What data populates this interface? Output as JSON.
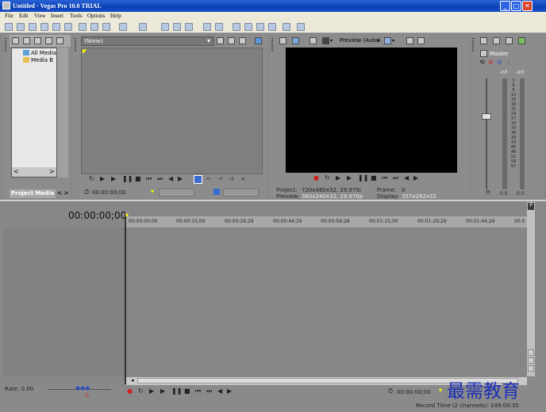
{
  "window": {
    "title": "Untitled - Vegas Pro 10.0 TRIAL",
    "min": "_",
    "max": "□",
    "close": "✕"
  },
  "menu": [
    "File",
    "Edit",
    "View",
    "Insert",
    "Tools",
    "Options",
    "Help"
  ],
  "explorer": {
    "items": [
      "All Media",
      "Media B"
    ],
    "tab": "Project Media"
  },
  "trimmer": {
    "source": "(None)",
    "timecode": "00:00:00;00"
  },
  "preview": {
    "mode": "Preview (Auto)",
    "project_label": "Project:",
    "project_value": "720x480x32, 29.970i",
    "preview_label": "Preview:",
    "preview_value": "360x240x32, 29.970p",
    "frame_label": "Frame:",
    "frame_value": "0",
    "display_label": "Display:",
    "display_value": "357x262x32"
  },
  "mixer": {
    "master": "Master",
    "inf_left": "-Inf.",
    "inf_right": "-Inf.",
    "db_ticks": [
      "3",
      "6",
      "9",
      "12",
      "15",
      "18",
      "21",
      "24",
      "27",
      "30",
      "33",
      "36",
      "39",
      "42",
      "45",
      "48",
      "51",
      "54",
      "57"
    ],
    "bottom_left": "0.0",
    "bottom_right": "0.0"
  },
  "timeline": {
    "timecode": "00:00:00;00",
    "ruler_ticks": [
      "00:00:00;00",
      "00:00:15;00",
      "00:00:29;29",
      "00:00:44;29",
      "00:00:59;28",
      "00:01:15;00",
      "00:01:29;29",
      "00:01:44;29",
      "00:0"
    ]
  },
  "bottom": {
    "rate": "Rate: 0.00",
    "timecode": "00:00:00;00",
    "record_time": "Record Time (2 channels): 149:00:35"
  },
  "watermark": "最需教育"
}
